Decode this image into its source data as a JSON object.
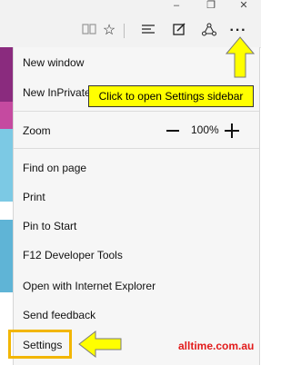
{
  "toolbar": {
    "icons": [
      "reading-view-icon",
      "favorite-star-icon",
      "hub-icon",
      "web-note-icon",
      "share-icon",
      "more-actions-icon"
    ]
  },
  "menu": {
    "new_window": "New window",
    "new_inprivate_window": "New InPrivate window",
    "zoom_label": "Zoom",
    "zoom_value": "100%",
    "find_on_page": "Find on page",
    "print": "Print",
    "pin_to_start": "Pin to Start",
    "f12_tools": "F12 Developer Tools",
    "open_with_ie": "Open with Internet Explorer",
    "send_feedback": "Send feedback",
    "settings": "Settings"
  },
  "annotations": {
    "callout_text": "Click to open Settings sidebar",
    "watermark": "alltime.com.au",
    "arrow_color": "#ffff00",
    "highlight_color": "#f2b600",
    "watermark_color": "#e21b1b"
  }
}
